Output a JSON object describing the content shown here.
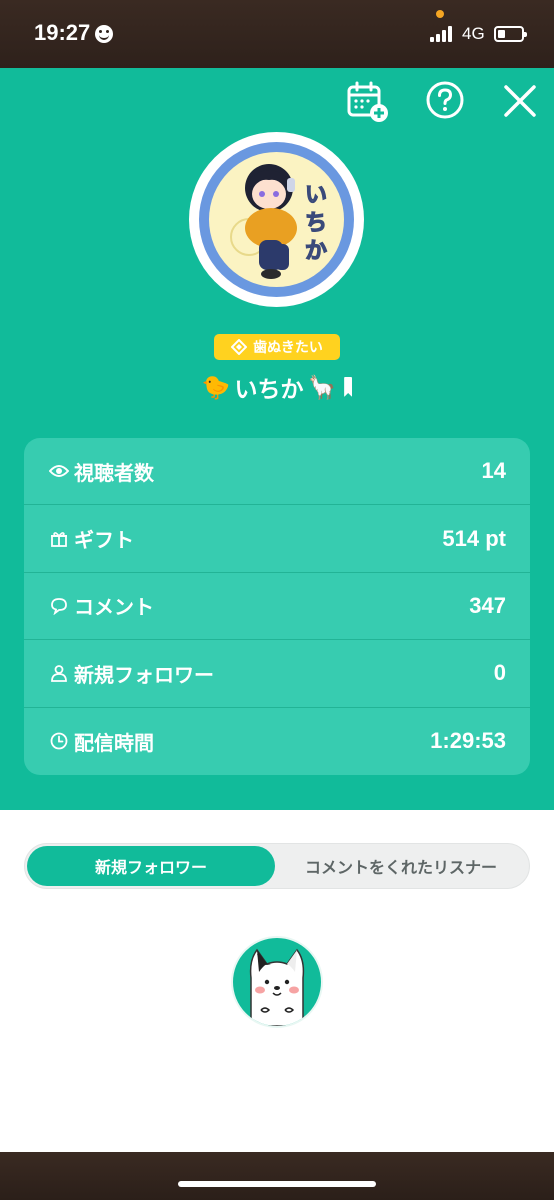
{
  "status_bar": {
    "time": "19:27",
    "network": "4G",
    "battery_level": 0.25
  },
  "header": {
    "icons": [
      "calendar-add-icon",
      "help-icon",
      "close-icon"
    ]
  },
  "profile": {
    "badge_label": "歯ぬきたい",
    "name": "いちか",
    "name_prefix_emoji": "🐤",
    "name_suffix_emoji": "🦙"
  },
  "stats": [
    {
      "label": "視聴者数",
      "value": "14",
      "icon": "eye-icon"
    },
    {
      "label": "ギフト",
      "value": "514 pt",
      "icon": "gift-icon"
    },
    {
      "label": "コメント",
      "value": "347",
      "icon": "speech-bubble-icon"
    },
    {
      "label": "新規フォロワー",
      "value": "0",
      "icon": "person-icon"
    },
    {
      "label": "配信時間",
      "value": "1:29:53",
      "icon": "clock-icon"
    }
  ],
  "tabs": [
    {
      "label": "新規フォロワー",
      "active": true
    },
    {
      "label": "コメントをくれたリスナー",
      "active": false
    }
  ],
  "colors": {
    "accent": "#11bb9a",
    "stats_card": "#37ccb0",
    "badge": "#ffd21f"
  }
}
